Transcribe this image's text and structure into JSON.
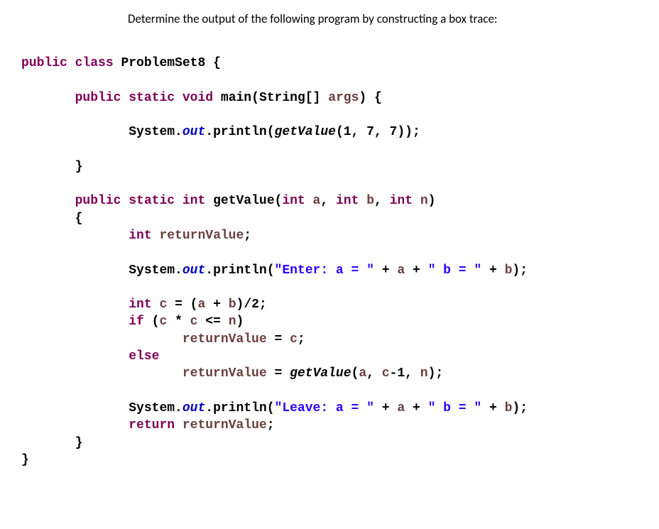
{
  "instruction": "Determine the output of the following program by constructing a box trace:",
  "code": {
    "kw_public": "public",
    "kw_class": "class",
    "kw_static": "static",
    "kw_void": "void",
    "kw_int": "int",
    "kw_if": "if",
    "kw_else": "else",
    "kw_return": "return",
    "className": "ProblemSet8",
    "main": "main",
    "stringArr": "String[]",
    "args": "args",
    "system": "System",
    "out": "out",
    "println": "println",
    "getValue": "getValue",
    "mainCallArgs": "(1, 7, 7));",
    "param_a": "a",
    "param_b": "b",
    "param_n": "n",
    "returnValue": "returnValue",
    "str_enter": "\"Enter: a = \"",
    "str_b_eq": "\" b = \"",
    "str_leave": "\"Leave: a = \"",
    "var_c": "c",
    "expr_assign_c": " = (",
    "expr_plus": " + ",
    "expr_div2": ")/2;",
    "cond_open": " (",
    "cond_mult": " * ",
    "cond_le": " <= ",
    "cond_close": ")",
    "recCallArgs_open": "(",
    "recCall_cMinus1": "-1, ",
    "recCallArgs_close": ");",
    "assign_c": " = ",
    "semicolon": ";",
    "brace_open": "{",
    "brace_close": "}",
    "paren_close_brace": ") {",
    "paren_close": ")",
    "close_paren_semi": ");",
    "comma_sp": ", ",
    "plus_concat": " + ",
    "openParen": "("
  }
}
